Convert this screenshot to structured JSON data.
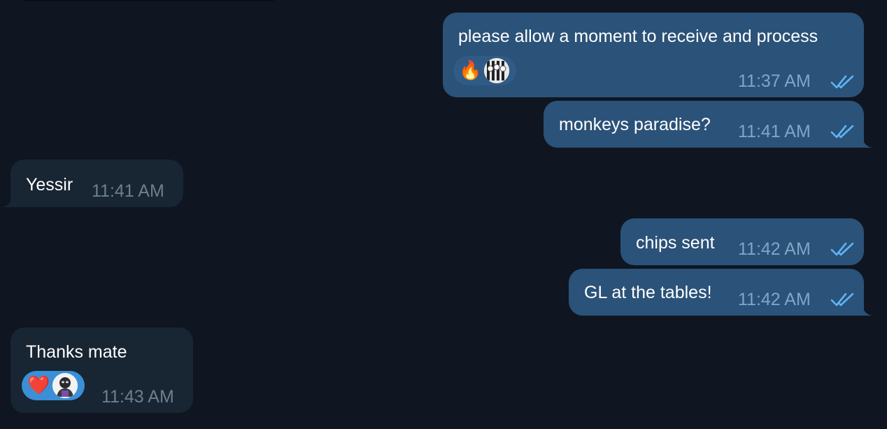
{
  "messages": [
    {
      "direction": "outgoing",
      "text": "please allow a moment to receive and process",
      "time": "11:37 AM",
      "status": "read",
      "reactions": [
        {
          "icon": "fire-emoji",
          "glyph": "🔥"
        },
        {
          "icon": "user-avatar",
          "glyph": ""
        }
      ]
    },
    {
      "direction": "outgoing",
      "text": "monkeys paradise?",
      "time": "11:41 AM",
      "status": "read"
    },
    {
      "direction": "incoming",
      "text": "Yessir",
      "time": "11:41 AM"
    },
    {
      "direction": "outgoing",
      "text": "chips sent",
      "time": "11:42 AM",
      "status": "read"
    },
    {
      "direction": "outgoing",
      "text": "GL at the tables!",
      "time": "11:42 AM",
      "status": "read"
    },
    {
      "direction": "incoming",
      "text": "Thanks mate",
      "time": "11:43 AM",
      "reactions": [
        {
          "icon": "red-heart-emoji",
          "glyph": "❤️"
        },
        {
          "icon": "user-avatar",
          "glyph": ""
        }
      ]
    }
  ],
  "colors": {
    "background": "#0f1621",
    "outgoing_bubble": "#2b5278",
    "incoming_bubble": "#182533",
    "read_ticks": "#5fb3f5"
  }
}
